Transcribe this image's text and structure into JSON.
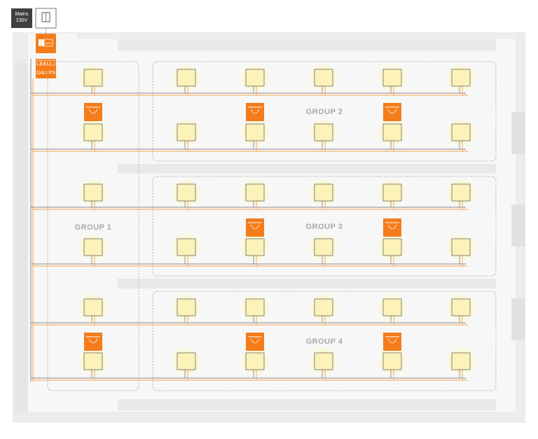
{
  "mains": {
    "line1": "Mains",
    "line2": "230V"
  },
  "controller": {
    "badge": "DALI",
    "label": "DALI PS"
  },
  "groups": [
    {
      "label": "GROUP 1"
    },
    {
      "label": "GROUP 2"
    },
    {
      "label": "GROUP 3"
    },
    {
      "label": "GROUP 4"
    }
  ],
  "colors": {
    "wire_orange": "#f7a24b",
    "wire_grey": "#8a8a8a",
    "sensor": "#f47c1a",
    "luminaire_fill": "#fff7c2",
    "glow": "#fff3a0",
    "floor": "#ececec"
  }
}
